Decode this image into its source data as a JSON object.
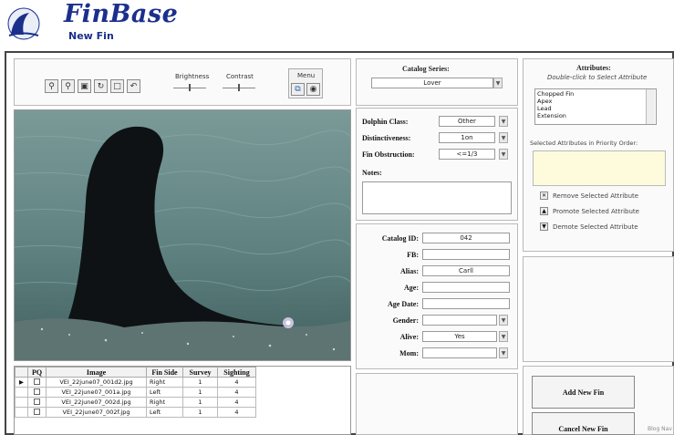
{
  "app": {
    "name": "FinBase",
    "subtitle": "New Fin"
  },
  "toolbar": {
    "icons": [
      "zoom-in-icon",
      "zoom-out-icon",
      "fit-icon",
      "rotate-icon",
      "crop-icon",
      "undo-icon"
    ],
    "brightness_label": "Brightness",
    "contrast_label": "Contrast",
    "menu_label": "Menu"
  },
  "catalog_series": {
    "title": "Catalog Series:",
    "value": "Lover"
  },
  "dolphin": {
    "class_label": "Dolphin Class:",
    "class_value": "Other",
    "distinct_label": "Distinctiveness:",
    "distinct_value": "1on",
    "obstruction_label": "Fin Obstruction:",
    "obstruction_value": "<=1/3",
    "notes_label": "Notes:"
  },
  "catalog": {
    "id_label": "Catalog ID:",
    "id_value": "042",
    "fb_label": "FB:",
    "fb_value": "",
    "alias_label": "Alias:",
    "alias_value": "Carll",
    "age_label": "Age:",
    "age_value": "",
    "agedate_label": "Age Date:",
    "agedate_value": "",
    "gender_label": "Gender:",
    "gender_value": "",
    "alive_label": "Alive:",
    "alive_value": "Yes",
    "mom_label": "Mom:",
    "mom_value": ""
  },
  "attributes": {
    "title": "Attributes:",
    "hint": "Double-click to Select Attribute",
    "items": [
      "Chopped Fin",
      "Apex",
      "Lead",
      "Extension"
    ],
    "selected_label": "Selected Attributes in Priority Order:",
    "remove_label": "Remove Selected Attribute",
    "promote_label": "Promote Selected Attribute",
    "demote_label": "Demote Selected Attribute"
  },
  "grid": {
    "headers": [
      "PQ",
      "Image",
      "Fin Side",
      "Survey",
      "Sighting"
    ],
    "rows": [
      {
        "image": "VEI_22june07_001d2.jpg",
        "side": "Right",
        "survey": "1",
        "sighting": "4"
      },
      {
        "image": "VEI_22june07_001a.jpg",
        "side": "Left",
        "survey": "1",
        "sighting": "4"
      },
      {
        "image": "VEI_22june07_002d.jpg",
        "side": "Right",
        "survey": "1",
        "sighting": "4"
      },
      {
        "image": "VEI_22june07_002f.jpg",
        "side": "Left",
        "survey": "1",
        "sighting": "4"
      }
    ]
  },
  "buttons": {
    "add": "Add New Fin",
    "cancel": "Cancel New Fin"
  },
  "status": {
    "text": "Blog Nav"
  }
}
